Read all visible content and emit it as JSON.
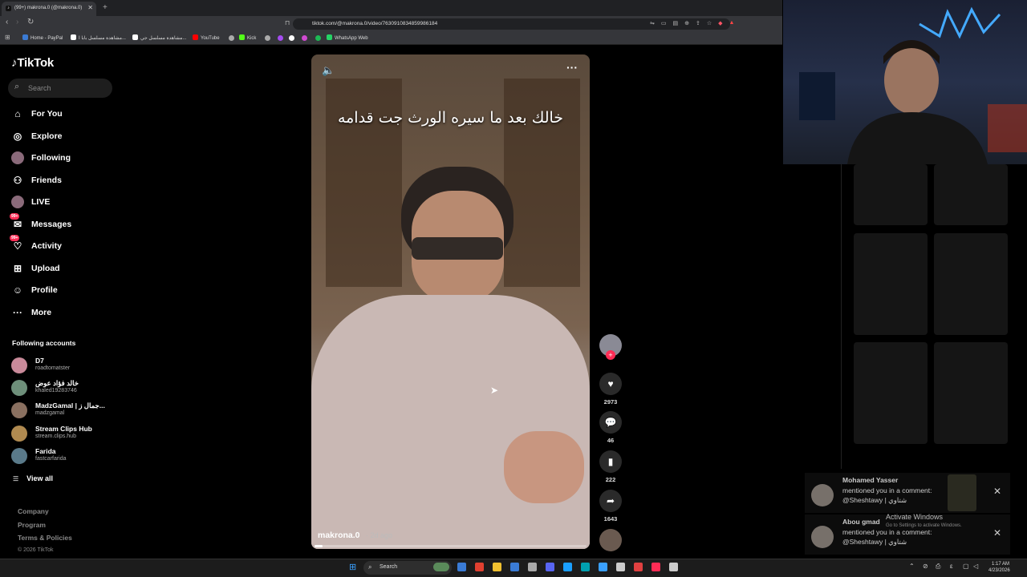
{
  "browser": {
    "tab_title": "(99+) makrona.0 (@makrona.0)",
    "url": "tiktok.com/@makrona.0/video/7630910834859986184",
    "bookmarks": [
      {
        "label": "Home - PayPal",
        "color": "#3b7bd4"
      },
      {
        "label": "مشاهدة مسلسل بابا ا...",
        "color": "#ffffff"
      },
      {
        "label": "مشاهدة مسلسل جي...",
        "color": "#ffffff"
      },
      {
        "label": "YouTube",
        "color": "#ff0000"
      },
      {
        "label": "Kick",
        "color": "#53fc18"
      },
      {
        "label": "WhatsApp Web",
        "color": "#25d366"
      }
    ]
  },
  "sidebar": {
    "logo": "TikTok",
    "search_placeholder": "Search",
    "nav": [
      {
        "label": "For You",
        "icon": "home-icon"
      },
      {
        "label": "Explore",
        "icon": "compass-icon"
      },
      {
        "label": "Following",
        "icon": "following-avatar-icon"
      },
      {
        "label": "Friends",
        "icon": "friends-icon"
      },
      {
        "label": "LIVE",
        "icon": "live-avatar-icon"
      },
      {
        "label": "Messages",
        "icon": "messages-icon",
        "badge": "99+"
      },
      {
        "label": "Activity",
        "icon": "activity-icon",
        "badge": "99+"
      },
      {
        "label": "Upload",
        "icon": "upload-icon"
      },
      {
        "label": "Profile",
        "icon": "profile-icon"
      },
      {
        "label": "More",
        "icon": "more-icon"
      }
    ],
    "following_title": "Following accounts",
    "accounts": [
      {
        "name": "D7",
        "handle": "roadtomatster",
        "color": "#c98a9a"
      },
      {
        "name": "خالد فؤاد عوض",
        "handle": "khaled19283746",
        "color": "#6e8f7a"
      },
      {
        "name": "MadzGamal | جمال ز...",
        "handle": "madzgamal",
        "color": "#8a7060"
      },
      {
        "name": "Stream Clips Hub",
        "handle": "stream.clips.hub",
        "color": "#b08a50"
      },
      {
        "name": "Farida",
        "handle": "fastcarfarida",
        "color": "#5a7a8a"
      }
    ],
    "view_all": "View all",
    "footer": [
      "Company",
      "Program",
      "Terms & Policies"
    ],
    "copyright": "© 2026 TikTok"
  },
  "video": {
    "caption": "خالك بعد ما سيره الورث جت قدامه",
    "author": "makrona.0",
    "posted": "· 2d ago",
    "progress": 0.03
  },
  "actions": {
    "likes": "2973",
    "comments": "46",
    "saves": "222",
    "shares": "1643"
  },
  "notifications": [
    {
      "user": "Mohamed Yasser",
      "text": "mentioned you in a comment: @Sheshtawy | شتاوي"
    },
    {
      "user": "Abou gmad",
      "text": "mentioned you in a comment: @Sheshtawy | شتاوي"
    }
  ],
  "watermark": {
    "title": "Activate Windows",
    "subtitle": "Go to Settings to activate Windows."
  },
  "taskbar": {
    "search": "Search",
    "time": "1:17 AM",
    "date": "4/23/2026"
  }
}
